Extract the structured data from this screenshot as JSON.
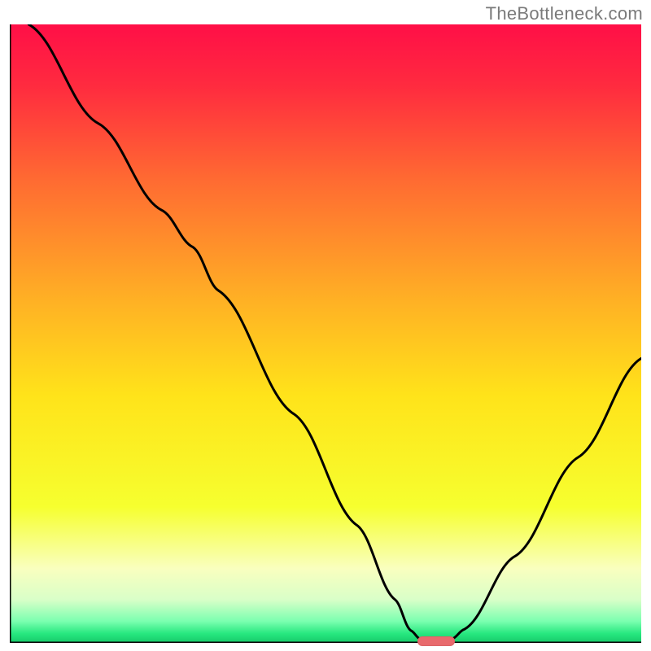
{
  "attribution": {
    "watermark": "TheBottleneck.com"
  },
  "colors": {
    "axis": "#000000",
    "curve": "#000000",
    "marker": "#e86a6d",
    "gradient_stops": [
      {
        "offset": 0.0,
        "color": "#ff0f47"
      },
      {
        "offset": 0.1,
        "color": "#ff2b3f"
      },
      {
        "offset": 0.25,
        "color": "#ff6a32"
      },
      {
        "offset": 0.45,
        "color": "#ffb224"
      },
      {
        "offset": 0.6,
        "color": "#ffe31a"
      },
      {
        "offset": 0.78,
        "color": "#f6ff2f"
      },
      {
        "offset": 0.88,
        "color": "#f9ffbf"
      },
      {
        "offset": 0.93,
        "color": "#d9ffc8"
      },
      {
        "offset": 0.965,
        "color": "#7bffb0"
      },
      {
        "offset": 0.985,
        "color": "#27e87f"
      },
      {
        "offset": 1.0,
        "color": "#16c96a"
      }
    ]
  },
  "chart_data": {
    "type": "line",
    "title": "",
    "xlabel": "",
    "ylabel": "",
    "xlim": [
      0,
      100
    ],
    "ylim": [
      0,
      100
    ],
    "grid": false,
    "series": [
      {
        "name": "bottleneck-curve",
        "points": [
          {
            "x": 3,
            "y": 100
          },
          {
            "x": 14,
            "y": 84
          },
          {
            "x": 24,
            "y": 70
          },
          {
            "x": 29,
            "y": 64
          },
          {
            "x": 33,
            "y": 57
          },
          {
            "x": 45,
            "y": 37
          },
          {
            "x": 55,
            "y": 19
          },
          {
            "x": 61,
            "y": 7
          },
          {
            "x": 63.5,
            "y": 2
          },
          {
            "x": 65,
            "y": 0.6
          },
          {
            "x": 70,
            "y": 0.6
          },
          {
            "x": 72,
            "y": 2.2
          },
          {
            "x": 80,
            "y": 14
          },
          {
            "x": 90,
            "y": 30
          },
          {
            "x": 100,
            "y": 46
          }
        ]
      }
    ],
    "annotations": [
      {
        "name": "sweet-spot-marker",
        "shape": "pill",
        "x_start": 64.5,
        "x_end": 70.5,
        "y": 0.2,
        "color": "#e86a6d"
      }
    ]
  }
}
